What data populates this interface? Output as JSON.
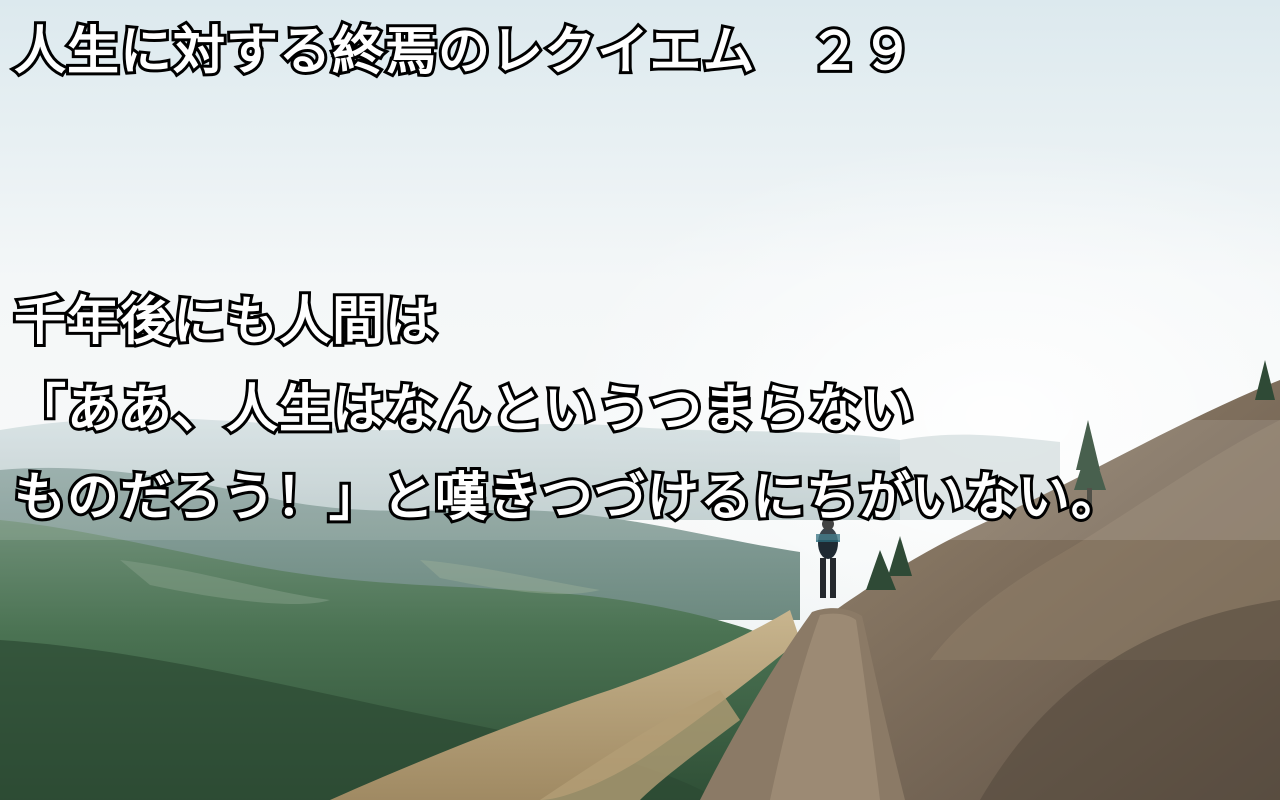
{
  "title": "人生に対する終焉のレクイエム　２９",
  "quote": {
    "lines": [
      "千年後にも人間は",
      "「ああ、人生はなんというつまらない",
      "ものだろう！」と嘆きつづけるにちがいない。"
    ]
  },
  "colors": {
    "text_fill": "#ffffff",
    "text_outline": "#000000",
    "sky": "#f3f6f7",
    "forest": "#3f6a4a",
    "slope": "#7a6c5c"
  }
}
